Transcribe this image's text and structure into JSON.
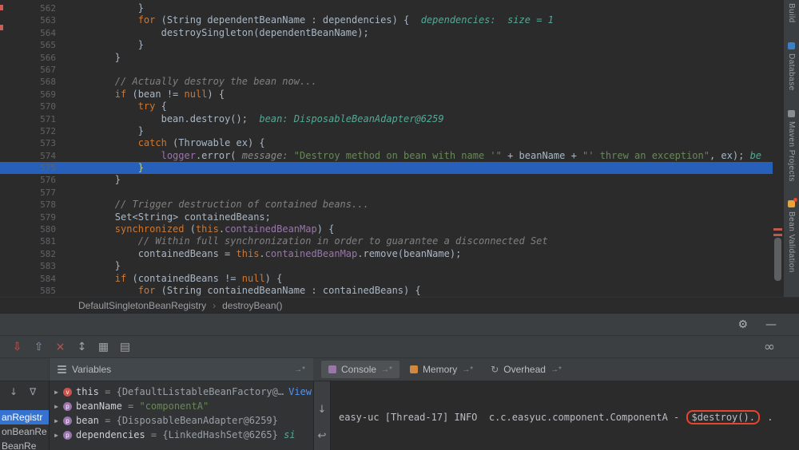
{
  "editor": {
    "current_line": 575,
    "scroll_marks": [
      286,
      293
    ],
    "lines": [
      {
        "num": 562,
        "indent": 3,
        "segments": [
          {
            "c": "plain",
            "t": "}"
          }
        ]
      },
      {
        "num": 563,
        "indent": 3,
        "segments": [
          {
            "c": "kw",
            "t": "for "
          },
          {
            "c": "plain",
            "t": "(String dependentBeanName : dependencies) {  "
          },
          {
            "c": "hint",
            "t": "dependencies:  size = 1"
          }
        ]
      },
      {
        "num": 564,
        "indent": 4,
        "segments": [
          {
            "c": "plain",
            "t": "destroySingleton(dependentBeanName);"
          }
        ]
      },
      {
        "num": 565,
        "indent": 3,
        "segments": [
          {
            "c": "plain",
            "t": "}"
          }
        ]
      },
      {
        "num": 566,
        "indent": 2,
        "segments": [
          {
            "c": "plain",
            "t": "}"
          }
        ]
      },
      {
        "num": 567,
        "indent": 0,
        "segments": []
      },
      {
        "num": 568,
        "indent": 2,
        "segments": [
          {
            "c": "cmt",
            "t": "// Actually destroy the bean now..."
          }
        ]
      },
      {
        "num": 569,
        "indent": 2,
        "segments": [
          {
            "c": "kw",
            "t": "if "
          },
          {
            "c": "plain",
            "t": "(bean != "
          },
          {
            "c": "kw",
            "t": "null"
          },
          {
            "c": "plain",
            "t": ") {"
          }
        ]
      },
      {
        "num": 570,
        "indent": 3,
        "segments": [
          {
            "c": "kw",
            "t": "try "
          },
          {
            "c": "plain",
            "t": "{"
          }
        ]
      },
      {
        "num": 571,
        "indent": 4,
        "segments": [
          {
            "c": "plain",
            "t": "bean.destroy();  "
          },
          {
            "c": "hint",
            "t": "bean: DisposableBeanAdapter@6259"
          }
        ]
      },
      {
        "num": 572,
        "indent": 3,
        "segments": [
          {
            "c": "plain",
            "t": "}"
          }
        ]
      },
      {
        "num": 573,
        "indent": 3,
        "segments": [
          {
            "c": "kw",
            "t": "catch "
          },
          {
            "c": "plain",
            "t": "(Throwable ex) {"
          }
        ]
      },
      {
        "num": 574,
        "indent": 4,
        "segments": [
          {
            "c": "field",
            "t": "logger"
          },
          {
            "c": "plain",
            "t": ".error( "
          },
          {
            "c": "param",
            "t": "message: "
          },
          {
            "c": "str",
            "t": "\"Destroy method on bean with name '\""
          },
          {
            "c": "plain",
            "t": " + beanName + "
          },
          {
            "c": "str",
            "t": "\"' threw an exception\""
          },
          {
            "c": "plain",
            "t": ", ex); "
          },
          {
            "c": "hint",
            "t": "be"
          }
        ]
      },
      {
        "num": 575,
        "indent": 3,
        "segments": [
          {
            "c": "exec",
            "t": "}"
          }
        ]
      },
      {
        "num": 576,
        "indent": 2,
        "segments": [
          {
            "c": "plain",
            "t": "}"
          }
        ]
      },
      {
        "num": 577,
        "indent": 0,
        "segments": []
      },
      {
        "num": 578,
        "indent": 2,
        "segments": [
          {
            "c": "cmt",
            "t": "// Trigger destruction of contained beans..."
          }
        ]
      },
      {
        "num": 579,
        "indent": 2,
        "segments": [
          {
            "c": "plain",
            "t": "Set<String> containedBeans;"
          }
        ]
      },
      {
        "num": 580,
        "indent": 2,
        "segments": [
          {
            "c": "kw",
            "t": "synchronized "
          },
          {
            "c": "plain",
            "t": "("
          },
          {
            "c": "kw",
            "t": "this"
          },
          {
            "c": "plain",
            "t": "."
          },
          {
            "c": "field",
            "t": "containedBeanMap"
          },
          {
            "c": "plain",
            "t": ") {"
          }
        ]
      },
      {
        "num": 581,
        "indent": 3,
        "segments": [
          {
            "c": "cmt",
            "t": "// Within full synchronization in order to guarantee a disconnected Set"
          }
        ]
      },
      {
        "num": 582,
        "indent": 3,
        "segments": [
          {
            "c": "plain",
            "t": "containedBeans = "
          },
          {
            "c": "kw",
            "t": "this"
          },
          {
            "c": "plain",
            "t": "."
          },
          {
            "c": "field",
            "t": "containedBeanMap"
          },
          {
            "c": "plain",
            "t": ".remove(beanName);"
          }
        ]
      },
      {
        "num": 583,
        "indent": 2,
        "segments": [
          {
            "c": "plain",
            "t": "}"
          }
        ]
      },
      {
        "num": 584,
        "indent": 2,
        "segments": [
          {
            "c": "kw",
            "t": "if "
          },
          {
            "c": "plain",
            "t": "(containedBeans != "
          },
          {
            "c": "kw",
            "t": "null"
          },
          {
            "c": "plain",
            "t": ") {"
          }
        ]
      },
      {
        "num": 585,
        "indent": 3,
        "segments": [
          {
            "c": "kw",
            "t": "for "
          },
          {
            "c": "plain",
            "t": "(String containedBeanName : containedBeans) {"
          }
        ]
      }
    ]
  },
  "right_strip": {
    "items": [
      {
        "label": "Build"
      },
      {
        "label": "Database",
        "icon_color": "#3b80c4"
      },
      {
        "label": "Maven Projects",
        "icon_color": "#8a8d90"
      },
      {
        "label": "Bean Validation",
        "icon_color": "#e8a33d",
        "badge": "#e8442e"
      }
    ]
  },
  "breadcrumbs": {
    "items": [
      "DefaultSingletonBeanRegistry",
      "destroyBean()"
    ],
    "separator": "›"
  },
  "debug_header": {
    "gear_glyph": "⚙",
    "minimize_glyph": "—"
  },
  "debug_toolbar": {
    "icons": [
      {
        "name": "move-down-stack-icon",
        "glyph": "⇩",
        "color": "#c75450"
      },
      {
        "name": "move-up-stack-icon",
        "glyph": "⇧",
        "color": "#6a99c6"
      },
      {
        "name": "remove-watch-icon",
        "glyph": "×",
        "color": "#c75450"
      },
      {
        "name": "sort-icon",
        "glyph": "↕",
        "color": "#9fa2a5"
      },
      {
        "name": "layout-grid-icon",
        "glyph": "▦",
        "color": "#9fa2a5"
      },
      {
        "name": "view-options-icon",
        "glyph": "▤",
        "color": "#9fa2a5"
      }
    ],
    "infinity_glyph": "∞"
  },
  "tabs": {
    "variables_label": "Variables",
    "focus_glyph": "→*",
    "right_tabs": [
      {
        "label": "Console",
        "icon": "console-icon",
        "icon_color": "#9876aa",
        "active": true
      },
      {
        "label": "Memory",
        "icon": "memory-icon",
        "icon_color": "#d0883f",
        "active": false
      },
      {
        "label": "Overhead",
        "icon": "overhead-icon",
        "glyph": "↻",
        "active": false
      }
    ]
  },
  "frames": {
    "down_glyph": "↓",
    "filter_glyph": "∇",
    "items": [
      {
        "label": "anRegistr",
        "selected": true
      },
      {
        "label": "onBeanRe",
        "selected": false
      },
      {
        "label": "BeanRe",
        "selected": false
      }
    ]
  },
  "variables": {
    "rows": [
      {
        "expander": "▶",
        "icon_letter": "v",
        "icon_color": "#c75450",
        "name": "this",
        "eq": " = ",
        "value": "{DefaultListableBeanFactory@…",
        "link": "View"
      },
      {
        "expander": "▶",
        "icon_letter": "p",
        "icon_color": "#9876aa",
        "name": "beanName",
        "eq": " = ",
        "value_string": "\"componentA\""
      },
      {
        "expander": "▶",
        "icon_letter": "p",
        "icon_color": "#9876aa",
        "name": "bean",
        "eq": " = ",
        "value": "{DisposableBeanAdapter@6259}"
      },
      {
        "expander": "▶",
        "icon_letter": "p",
        "icon_color": "#9876aa",
        "name": "dependencies",
        "eq": " = ",
        "value": "{LinkedHashSet@6265}",
        "hint": " si"
      }
    ]
  },
  "console": {
    "down_glyph": "↓",
    "softwrap_glyph": "↩",
    "line": {
      "prefix": "easy-uc [Thread-17] INFO  c.c.easyuc.component.ComponentA - ",
      "highlight": "$destroy().",
      "suffix": " ."
    }
  },
  "colors": {
    "editor_bg": "#2b2b2b",
    "panel_bg": "#3c3f41",
    "execution_line_bg": "#2760ba",
    "selected_frame_bg": "#3672d0",
    "annotation_red": "#e8442e",
    "string_green": "#6a8759",
    "keyword_orange": "#cc7832",
    "hint_teal": "#56a896"
  }
}
